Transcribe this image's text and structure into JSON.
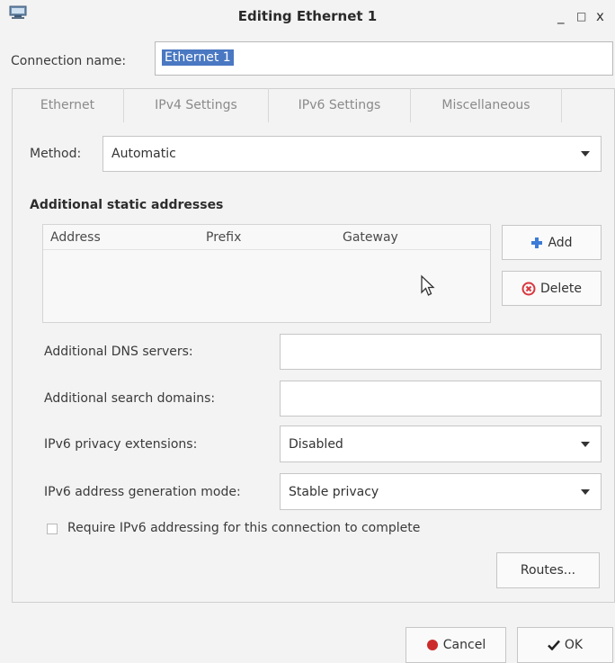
{
  "window": {
    "title": "Editing Ethernet 1",
    "minimize_glyph": "_",
    "maximize_glyph": "□",
    "close_glyph": "x"
  },
  "connection": {
    "label": "Connection name:",
    "value": "Ethernet 1"
  },
  "tabs": [
    {
      "label": "Ethernet"
    },
    {
      "label": "IPv4 Settings"
    },
    {
      "label": "IPv6 Settings"
    },
    {
      "label": "Miscellaneous"
    }
  ],
  "method": {
    "label": "Method:",
    "value": "Automatic"
  },
  "addresses": {
    "title": "Additional static addresses",
    "columns": [
      "Address",
      "Prefix",
      "Gateway"
    ],
    "add_label": "Add",
    "delete_label": "Delete"
  },
  "dns": {
    "label": "Additional DNS servers:",
    "value": ""
  },
  "search_domains": {
    "label": "Additional search domains:",
    "value": ""
  },
  "privacy": {
    "label": "IPv6 privacy extensions:",
    "value": "Disabled"
  },
  "gen_mode": {
    "label": "IPv6 address generation mode:",
    "value": "Stable privacy"
  },
  "require": {
    "label": "Require IPv6 addressing for this connection to complete",
    "checked": false
  },
  "routes_label": "Routes...",
  "footer": {
    "cancel_label": "Cancel",
    "ok_label": "OK"
  },
  "colors": {
    "selection": "#4a78c2",
    "add_icon": "#3c7bd6",
    "delete_icon": "#d9363e",
    "cancel_icon": "#cc2a2a"
  }
}
